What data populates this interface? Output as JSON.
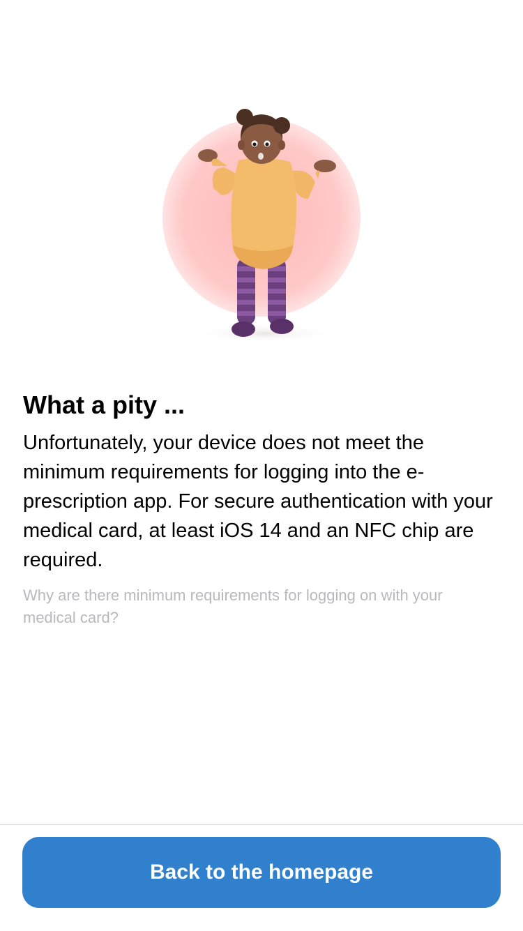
{
  "illustration": {
    "name": "shrugging-girl-illustration",
    "circle_color": "#ffc7c7"
  },
  "content": {
    "title": "What a pity ...",
    "body": "Unfortunately, your device does not meet the minimum requirements for logging into the e-prescription app. For secure authentication with your medical card, at least iOS 14 and an NFC chip are required.",
    "info_link": "Why are there minimum requirements for logging on with your medical card?"
  },
  "footer": {
    "button_label": "Back to the homepage",
    "button_color": "#3180cd"
  }
}
